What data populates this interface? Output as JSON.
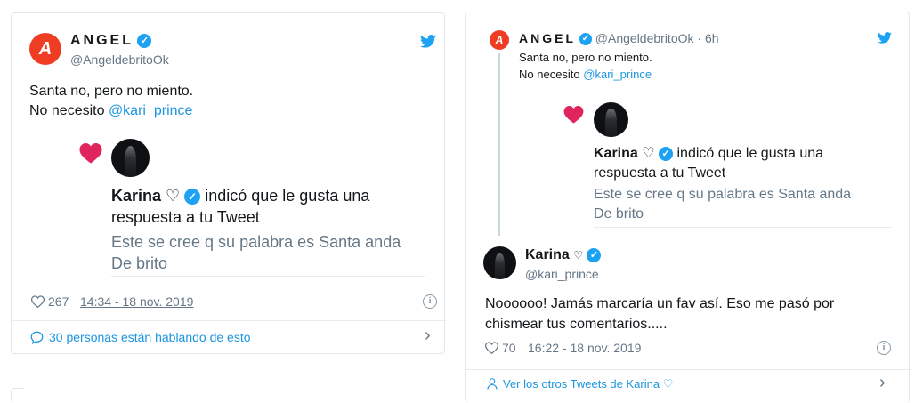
{
  "left": {
    "author_name": "ANGEL",
    "author_handle": "@AngeldebritoOk",
    "tweet_line1": "Santa no, pero no miento.",
    "tweet_line2_prefix": "No necesito ",
    "tweet_line2_mention": "@kari_prince",
    "embed_name": "Karina",
    "embed_heart": "♡",
    "embed_action_1": "indicó que le gusta una",
    "embed_action_2": "respuesta a tu Tweet",
    "embed_quote_1": "Este se cree q su palabra es Santa anda",
    "embed_quote_2": "De brito",
    "likes": "267",
    "timestamp": "14:34 - 18 nov. 2019",
    "conversation": "30 personas están hablando de esto"
  },
  "right": {
    "author_name": "ANGEL",
    "author_handle": "@AngeldebritoOk",
    "time_ago": "6h",
    "tweet_line1": "Santa no, pero no miento.",
    "tweet_line2_prefix": "No necesito ",
    "tweet_line2_mention": "@kari_prince",
    "embed_name": "Karina",
    "embed_heart": "♡",
    "embed_action_1": "indicó que le gusta una",
    "embed_action_2": "respuesta a tu Tweet",
    "embed_quote_1": "Este se cree q su palabra es Santa anda",
    "embed_quote_2": "De brito",
    "reply_name": "Karina",
    "reply_heart": "♡",
    "reply_handle": "@kari_prince",
    "reply_line1": "Noooooo! Jamás marcaría un fav así. Eso me pasó por",
    "reply_line2": "chismear tus comentarios.....",
    "likes": "70",
    "timestamp": "16:22 - 18 nov. 2019",
    "see_more": "Ver los otros Tweets de Karina ♡"
  },
  "colors": {
    "twitter_blue": "#1da1f2",
    "link_blue": "#1b95e0",
    "heart_red": "#e0245e",
    "avatar_red": "#ef3d24"
  },
  "icons": [
    "twitter-bird-icon",
    "verified-badge-icon",
    "heart-icon",
    "info-icon",
    "speech-bubble-icon",
    "chevron-right-icon",
    "person-icon"
  ]
}
